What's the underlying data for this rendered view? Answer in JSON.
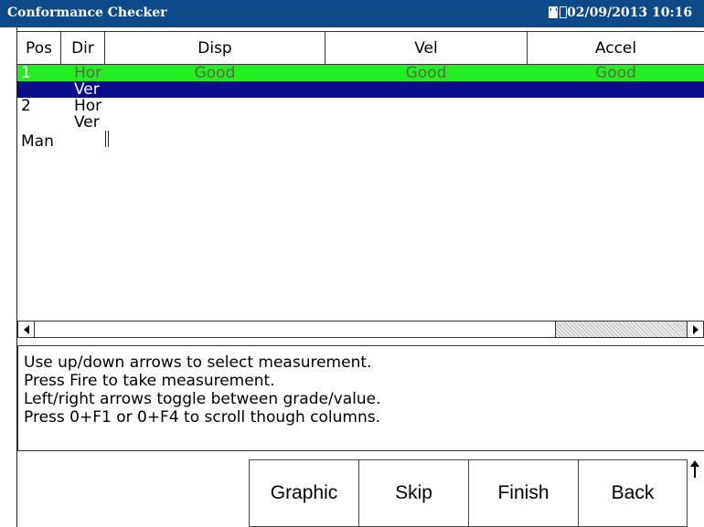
{
  "window": {
    "title": "Conformance Checker",
    "datetime": "02/09/2013 10:16",
    "icons": [
      "sd-card-icon",
      "battery-icon"
    ]
  },
  "table": {
    "columns": [
      "Pos",
      "Dir",
      "Disp",
      "Vel",
      "Accel"
    ],
    "rows": [
      {
        "pos": "1",
        "dir": "Hor",
        "disp": "Good",
        "vel": "Good",
        "accel": "Good",
        "state": "good"
      },
      {
        "pos": "",
        "dir": "Ver",
        "disp": "",
        "vel": "",
        "accel": "",
        "state": "selected"
      },
      {
        "pos": "2",
        "dir": "Hor",
        "disp": "",
        "vel": "",
        "accel": "",
        "state": "normal"
      },
      {
        "pos": "",
        "dir": "Ver",
        "disp": "",
        "vel": "",
        "accel": "",
        "state": "normal"
      }
    ],
    "extra_item": "Man"
  },
  "colors": {
    "titlebar": "#0d4a8a",
    "good_row": "#22ee22",
    "selected_row": "#0b0b8c"
  },
  "instructions": [
    "Use up/down arrows to select measurement.",
    "Press Fire to take measurement.",
    "Left/right arrows toggle between grade/value.",
    "Press 0+F1 or 0+F4 to scroll though columns."
  ],
  "buttons": {
    "graphic": "Graphic",
    "skip": "Skip",
    "finish": "Finish",
    "back": "Back"
  },
  "icons": {
    "scroll_left": "scroll-left-arrow-icon",
    "scroll_right": "scroll-right-arrow-icon",
    "page_up": "arrow-up-icon"
  }
}
